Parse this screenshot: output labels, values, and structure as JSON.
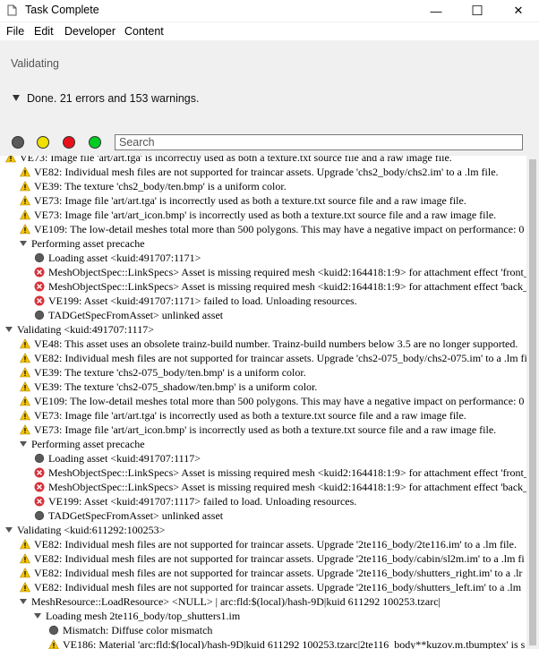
{
  "window": {
    "title": "Task Complete",
    "minimize": "—",
    "maximize": "☐",
    "close": "✕"
  },
  "menu": [
    "File",
    "Edit",
    "Developer",
    "Content"
  ],
  "status": "Validating",
  "summary": "Done. 21 errors and 153 warnings.",
  "filters": {
    "all_color": "#5a5a5a",
    "warning_color": "#f0e000",
    "error_color": "#e8101a",
    "info_color": "#00cc22"
  },
  "search": {
    "placeholder": "Search"
  },
  "log": [
    {
      "indent": 0,
      "icon": "warning",
      "text": "VE73: Image file 'art/art.tga' is incorrectly used as both a texture.txt source file and a raw image file.",
      "partial": true
    },
    {
      "indent": 1,
      "icon": "warning",
      "text": "VE82: Individual mesh files are not supported for traincar assets. Upgrade 'chs2_body/chs2.im' to a .lm file."
    },
    {
      "indent": 1,
      "icon": "warning",
      "text": "VE39: The texture 'chs2_body/ten.bmp' is a uniform color."
    },
    {
      "indent": 1,
      "icon": "warning",
      "text": "VE73: Image file 'art/art.tga' is incorrectly used as both a texture.txt source file and a raw image file."
    },
    {
      "indent": 1,
      "icon": "warning",
      "text": "VE73: Image file 'art/art_icon.bmp' is incorrectly used as both a texture.txt source file and a raw image file."
    },
    {
      "indent": 1,
      "icon": "warning",
      "text": "VE109: The low-detail meshes total more than 500 polygons. This may have a negative impact on performance: 0"
    },
    {
      "indent": 1,
      "icon": "expand",
      "text": "Performing asset precache"
    },
    {
      "indent": 2,
      "icon": "info",
      "text": "Loading asset <kuid:491707:1171>"
    },
    {
      "indent": 2,
      "icon": "error",
      "text": "MeshObjectSpec::LinkSpecs> Asset is missing required mesh <kuid2:164418:1:9> for attachment effect 'front_"
    },
    {
      "indent": 2,
      "icon": "error",
      "text": "MeshObjectSpec::LinkSpecs> Asset is missing required mesh <kuid2:164418:1:9> for attachment effect 'back_"
    },
    {
      "indent": 2,
      "icon": "error",
      "text": "VE199: Asset <kuid:491707:1171> failed to load. Unloading resources."
    },
    {
      "indent": 2,
      "icon": "info",
      "text": "TADGetSpecFromAsset> unlinked asset"
    },
    {
      "indent": 0,
      "icon": "expand",
      "text": "Validating <kuid:491707:1117>"
    },
    {
      "indent": 1,
      "icon": "warning",
      "text": "VE48: This asset uses an obsolete trainz-build number. Trainz-build numbers below 3.5 are no longer supported."
    },
    {
      "indent": 1,
      "icon": "warning",
      "text": "VE82: Individual mesh files are not supported for traincar assets. Upgrade 'chs2-075_body/chs2-075.im' to a .lm fil"
    },
    {
      "indent": 1,
      "icon": "warning",
      "text": "VE39: The texture 'chs2-075_body/ten.bmp' is a uniform color."
    },
    {
      "indent": 1,
      "icon": "warning",
      "text": "VE39: The texture 'chs2-075_shadow/ten.bmp' is a uniform color."
    },
    {
      "indent": 1,
      "icon": "warning",
      "text": "VE109: The low-detail meshes total more than 500 polygons. This may have a negative impact on performance: 0"
    },
    {
      "indent": 1,
      "icon": "warning",
      "text": "VE73: Image file 'art/art.tga' is incorrectly used as both a texture.txt source file and a raw image file."
    },
    {
      "indent": 1,
      "icon": "warning",
      "text": "VE73: Image file 'art/art_icon.bmp' is incorrectly used as both a texture.txt source file and a raw image file."
    },
    {
      "indent": 1,
      "icon": "expand",
      "text": "Performing asset precache"
    },
    {
      "indent": 2,
      "icon": "info",
      "text": "Loading asset <kuid:491707:1117>"
    },
    {
      "indent": 2,
      "icon": "error",
      "text": "MeshObjectSpec::LinkSpecs> Asset is missing required mesh <kuid2:164418:1:9> for attachment effect 'front_"
    },
    {
      "indent": 2,
      "icon": "error",
      "text": "MeshObjectSpec::LinkSpecs> Asset is missing required mesh <kuid2:164418:1:9> for attachment effect 'back_"
    },
    {
      "indent": 2,
      "icon": "error",
      "text": "VE199: Asset <kuid:491707:1117> failed to load. Unloading resources."
    },
    {
      "indent": 2,
      "icon": "info",
      "text": "TADGetSpecFromAsset> unlinked asset"
    },
    {
      "indent": 0,
      "icon": "expand",
      "text": "Validating <kuid:611292:100253>"
    },
    {
      "indent": 1,
      "icon": "warning",
      "text": "VE82: Individual mesh files are not supported for traincar assets. Upgrade '2te116_body/2te116.im' to a .lm file."
    },
    {
      "indent": 1,
      "icon": "warning",
      "text": "VE82: Individual mesh files are not supported for traincar assets. Upgrade '2te116_body/cabin/sl2m.im' to a .lm fi"
    },
    {
      "indent": 1,
      "icon": "warning",
      "text": "VE82: Individual mesh files are not supported for traincar assets. Upgrade '2te116_body/shutters_right.im' to a .lr"
    },
    {
      "indent": 1,
      "icon": "warning",
      "text": "VE82: Individual mesh files are not supported for traincar assets. Upgrade '2te116_body/shutters_left.im' to a .lm"
    },
    {
      "indent": 1,
      "icon": "expand",
      "text": "MeshResource::LoadResource> <NULL> | arc:fld:$(local)/hash-9D|kuid 611292 100253.tzarc|"
    },
    {
      "indent": 2,
      "icon": "expand",
      "text": "Loading mesh 2te116_body/top_shutters1.im"
    },
    {
      "indent": 3,
      "icon": "info",
      "text": "Mismatch: Diffuse color mismatch"
    },
    {
      "indent": 3,
      "icon": "warning",
      "text": "VE186: Material 'arc:fld:$(local)/hash-9D|kuid 611292 100253.tzarc|2te116_body**kuzov.m.tbumptex' is s"
    }
  ]
}
